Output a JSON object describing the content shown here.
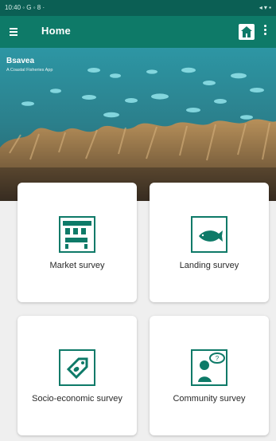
{
  "status_bar": {
    "left": "10:40 ◦ G ◦ 8 ·",
    "right": "◂ ▾ ▪"
  },
  "app_bar": {
    "title": "Home"
  },
  "hero": {
    "app_name": "Bsavea",
    "tagline": "A Coastal Fisheries App"
  },
  "cards": [
    {
      "label": "Market survey",
      "icon": "market-stall-icon"
    },
    {
      "label": "Landing survey",
      "icon": "fish-icon"
    },
    {
      "label": "Socio-economic survey",
      "icon": "price-tag-icon"
    },
    {
      "label": "Community survey",
      "icon": "person-speech-bubble-icon"
    }
  ],
  "colors": {
    "accent": "#0e7a68",
    "status_bar": "#0b5f54"
  }
}
